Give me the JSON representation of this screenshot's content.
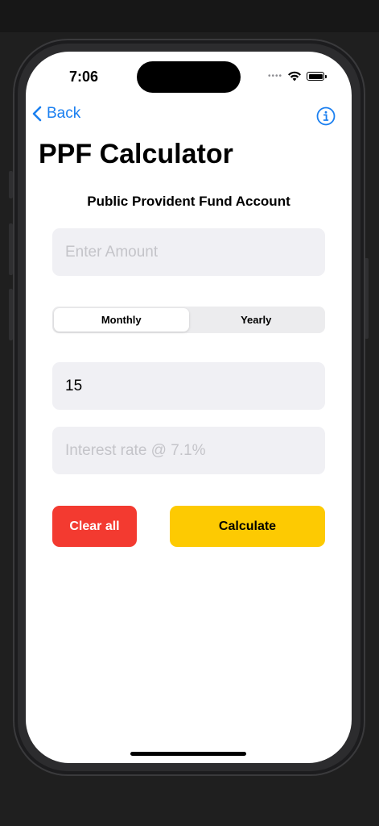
{
  "status_bar": {
    "time": "7:06",
    "signal": "signal-dots-icon",
    "wifi": "wifi-icon",
    "battery": "battery-icon"
  },
  "nav": {
    "back_label": "Back",
    "info_icon": "info-circle-icon"
  },
  "page": {
    "title": "PPF Calculator",
    "subtitle": "Public Provident Fund Account"
  },
  "form": {
    "amount": {
      "value": "",
      "placeholder": "Enter Amount"
    },
    "frequency": {
      "options": [
        "Monthly",
        "Yearly"
      ],
      "selected": "Monthly"
    },
    "years": {
      "value": "15",
      "placeholder": ""
    },
    "interest": {
      "value": "",
      "placeholder": "Interest rate @ 7.1%"
    }
  },
  "actions": {
    "clear_label": "Clear all",
    "calculate_label": "Calculate"
  },
  "colors": {
    "accent": "#1a7ff0",
    "clear_button": "#f33a30",
    "calculate_button": "#fdca02",
    "field_background": "#f0f0f4"
  }
}
